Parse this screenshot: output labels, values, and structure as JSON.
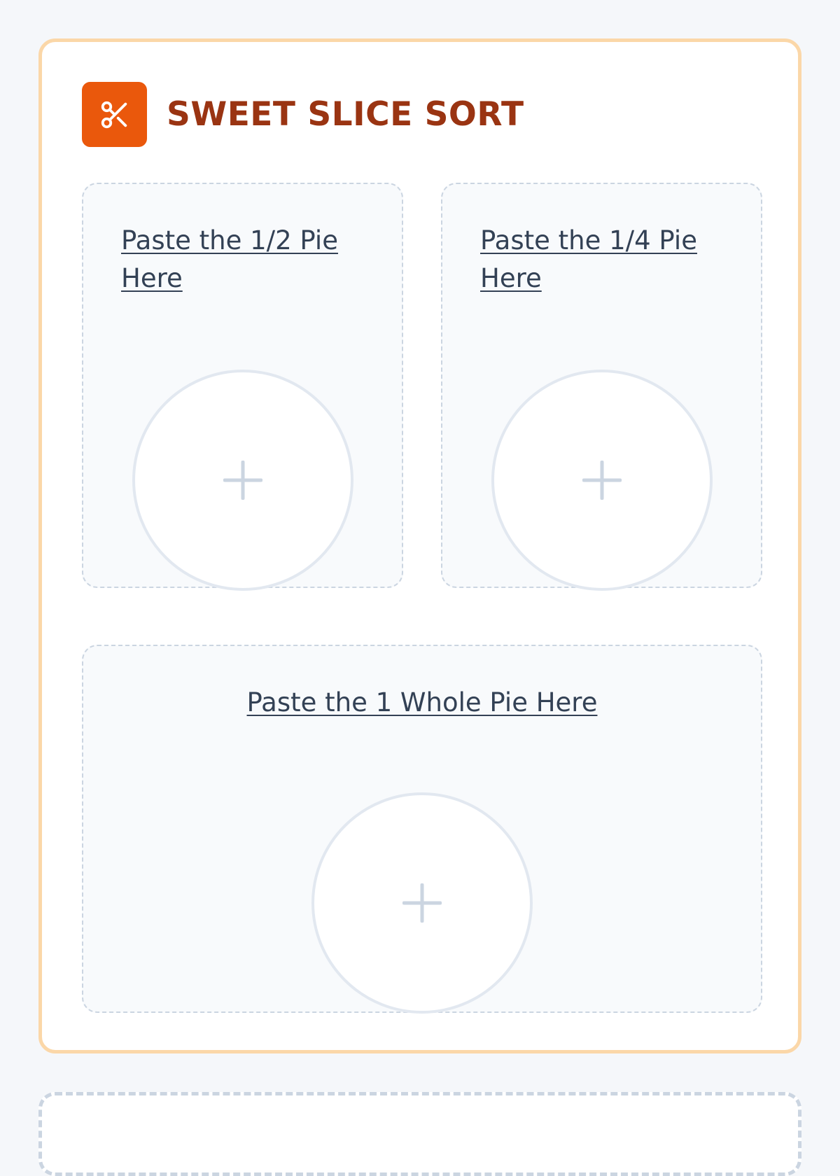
{
  "header": {
    "title": "SWEET SLICE SORT",
    "logo_icon": "scissors-icon"
  },
  "zones": {
    "half": {
      "label": "Paste the 1/2 Pie Here",
      "icon": "plus-icon"
    },
    "quarter": {
      "label": "Paste the 1/4 Pie Here",
      "icon": "plus-icon"
    },
    "whole": {
      "label": "Paste the 1 Whole Pie Here",
      "icon": "plus-icon"
    }
  },
  "colors": {
    "accent": "#ea580c",
    "title": "#9a3412",
    "card_border": "#fbd7a8",
    "label": "#334155",
    "plus": "#cbd5e1"
  }
}
